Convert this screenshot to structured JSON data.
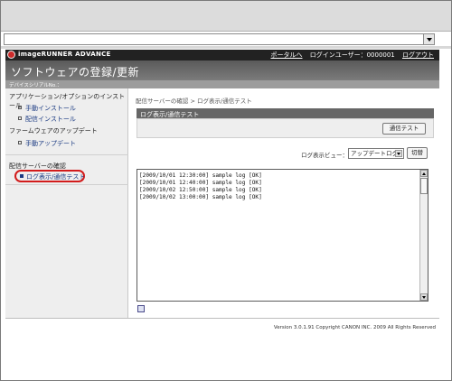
{
  "brand": {
    "name": "imageRUNNER ADVANCE",
    "portal_link": "ポータルへ",
    "login_user_label": "ログインユーザー：0000001",
    "logout_link": "ログアウト"
  },
  "page": {
    "title": "ソフトウェアの登録/更新",
    "device_serial_label": "デバイスシリアルNo.："
  },
  "sidebar": {
    "section_app": "アプリケーション/オプションのインストール",
    "item_manual_install": "手動インストール",
    "item_delivery_install": "配信インストール",
    "section_firmware": "ファームウェアのアップデート",
    "item_manual_update": "手動アップデート",
    "section_delivery": "配信サーバーの確認",
    "item_log_current": "ログ表示/通信テスト"
  },
  "content": {
    "breadcrumb": "配信サーバーの確認 > ログ表示/通信テスト",
    "panel_title": "ログ表示/通信テスト",
    "test_button": "通信テスト",
    "logview_label": "ログ表示ビュー：",
    "logview_value": "アップデートログ",
    "switch_button": "切替",
    "log_lines": [
      "[2009/10/01 12:30:00] sample log [OK]",
      "[2009/10/01 12:40:00] sample log [OK]",
      "[2009/10/02 12:50:00] sample log [OK]",
      "[2009/10/02 13:00:00] sample log [OK]"
    ]
  },
  "footer": {
    "copyright": "Version 3.0.1.91 Copyright CANON INC. 2009 All Rights Reserved"
  },
  "colors": {
    "accent_red": "#d21b1b",
    "link_blue": "#1a3a82",
    "title_bar": "#5a5a5a",
    "brand_bar": "#222222"
  }
}
